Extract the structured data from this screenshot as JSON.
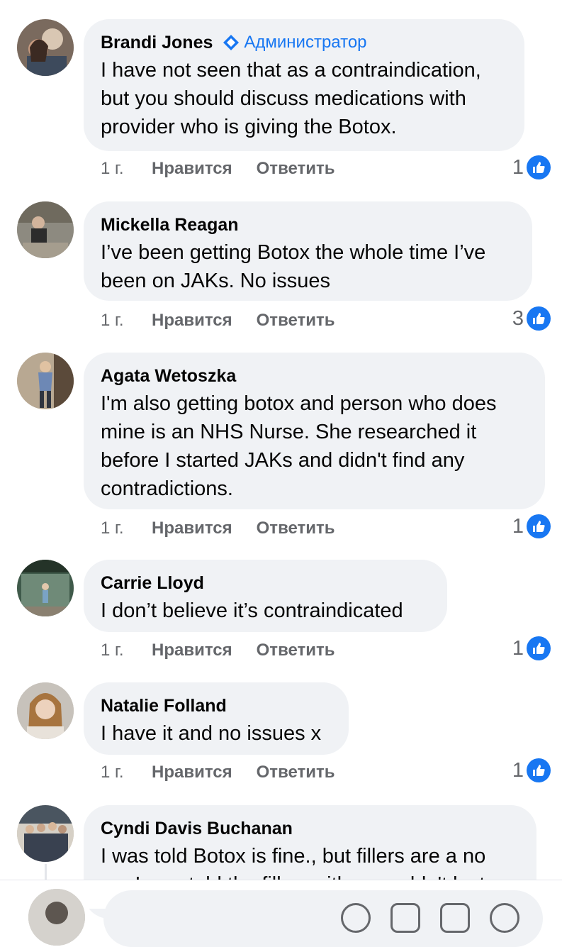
{
  "colors": {
    "accent": "#1877f2",
    "bubble": "#f0f2f5",
    "muted": "#65676b",
    "text": "#050505"
  },
  "comments": [
    {
      "author": "Brandi Jones",
      "badge": "Администратор",
      "text": "I have not seen that as a contraindication, but you should discuss medications with provider who is giving the Botox.",
      "time": "1 г.",
      "like_label": "Нравится",
      "reply_label": "Ответить",
      "reaction_count": "1"
    },
    {
      "author": "Mickella Reagan",
      "text": "I’ve been getting Botox the whole time I’ve been on JAKs. No issues",
      "time": "1 г.",
      "like_label": "Нравится",
      "reply_label": "Ответить",
      "reaction_count": "3"
    },
    {
      "author": "Agata Wetoszka",
      "text": "I'm also getting botox and person who does mine is an NHS Nurse. She researched it before I started JAKs and didn't find any contradictions.",
      "time": "1 г.",
      "like_label": "Нравится",
      "reply_label": "Ответить",
      "reaction_count": "1"
    },
    {
      "author": "Carrie Lloyd",
      "text": "I don’t believe it’s contraindicated",
      "time": "1 г.",
      "like_label": "Нравится",
      "reply_label": "Ответить",
      "reaction_count": "1"
    },
    {
      "author": "Natalie Folland",
      "text": "I have it and no issues x",
      "time": "1 г.",
      "like_label": "Нравится",
      "reply_label": "Ответить",
      "reaction_count": "1"
    },
    {
      "author": "Cyndi Davis Buchanan",
      "text": "I was told Botox is fine., but fillers are a no go. I was told the fillers either wouldn't last"
    }
  ]
}
